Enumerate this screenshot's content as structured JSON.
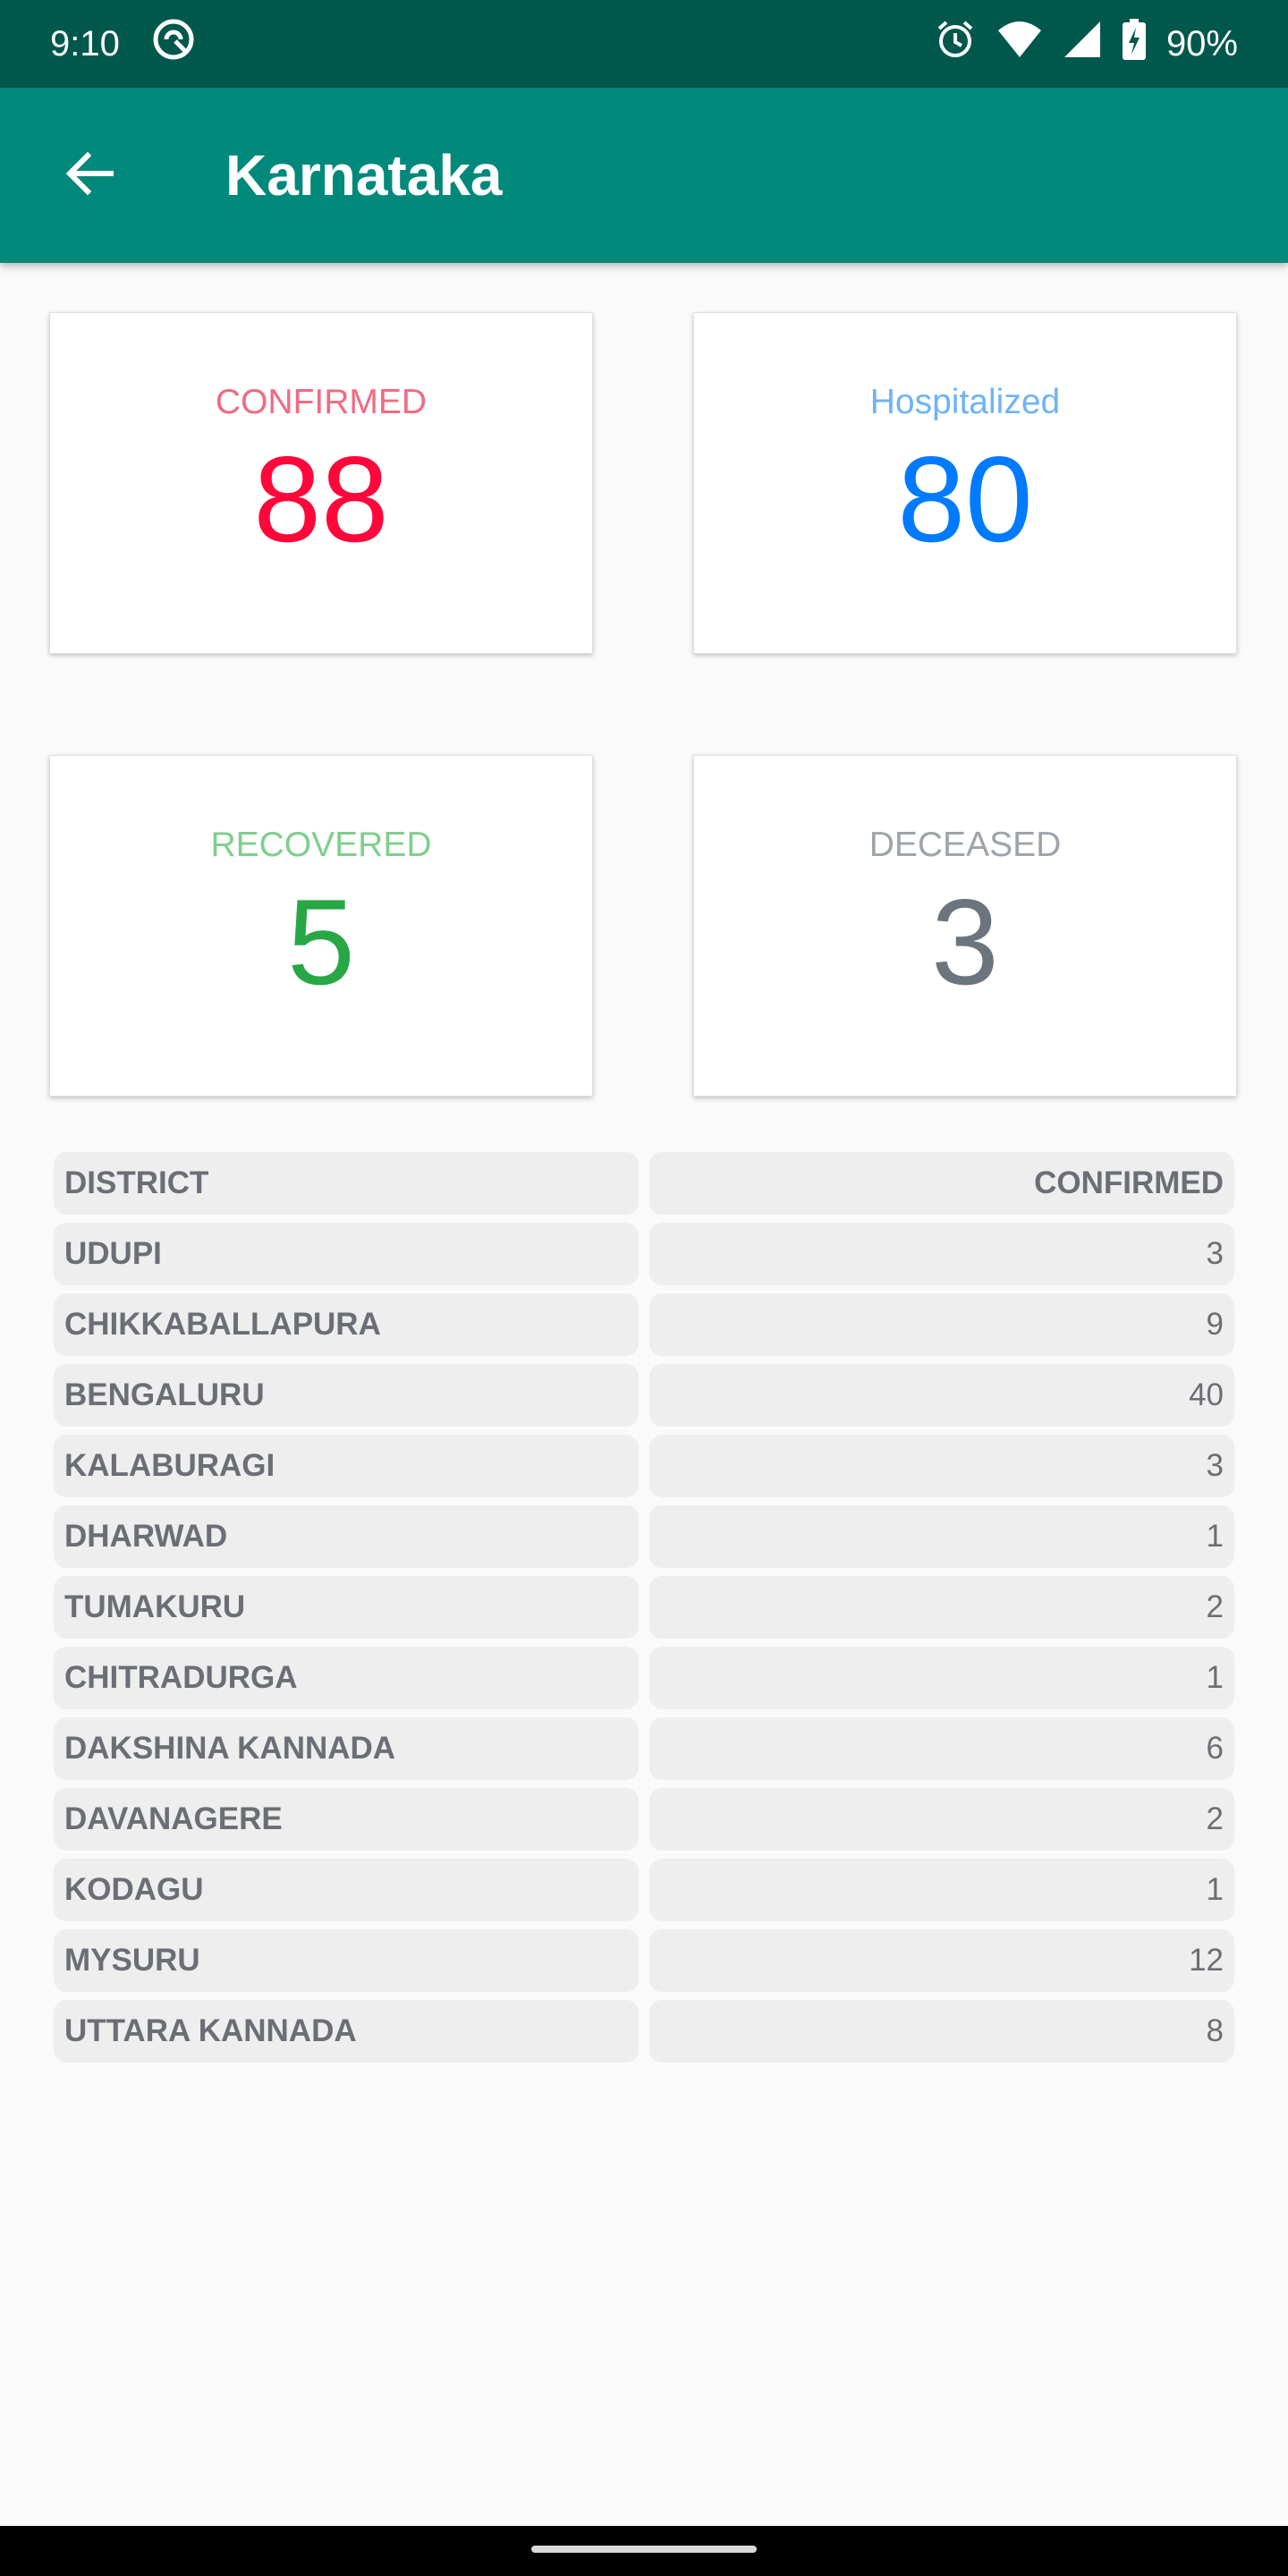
{
  "status_bar": {
    "time": "9:10",
    "battery": "90%",
    "icons": [
      "assistant-icon",
      "alarm-icon",
      "wifi-icon",
      "signal-icon",
      "battery-charging-icon"
    ]
  },
  "app_bar": {
    "title": "Karnataka",
    "back_icon": "arrow-back-icon"
  },
  "stats": [
    {
      "label": "CONFIRMED",
      "value": "88",
      "label_color": "#f06b82",
      "value_color": "#ff073a"
    },
    {
      "label": "Hospitalized",
      "value": "80",
      "label_color": "#6eb3f8",
      "value_color": "#007bff"
    },
    {
      "label": "RECOVERED",
      "value": "5",
      "label_color": "#7fcf8c",
      "value_color": "#28a745"
    },
    {
      "label": "DECEASED",
      "value": "3",
      "label_color": "#9fa4ab",
      "value_color": "#6c757d"
    }
  ],
  "table": {
    "headers": [
      "DISTRICT",
      "CONFIRMED"
    ],
    "rows": [
      {
        "district": "UDUPI",
        "confirmed": "3"
      },
      {
        "district": "CHIKKABALLAPURA",
        "confirmed": "9"
      },
      {
        "district": "BENGALURU",
        "confirmed": "40"
      },
      {
        "district": "KALABURAGI",
        "confirmed": "3"
      },
      {
        "district": "DHARWAD",
        "confirmed": "1"
      },
      {
        "district": "TUMAKURU",
        "confirmed": "2"
      },
      {
        "district": "CHITRADURGA",
        "confirmed": "1"
      },
      {
        "district": "DAKSHINA KANNADA",
        "confirmed": "6"
      },
      {
        "district": "DAVANAGERE",
        "confirmed": "2"
      },
      {
        "district": "KODAGU",
        "confirmed": "1"
      },
      {
        "district": "MYSURU",
        "confirmed": "12"
      },
      {
        "district": "UTTARA KANNADA",
        "confirmed": "8"
      }
    ]
  }
}
